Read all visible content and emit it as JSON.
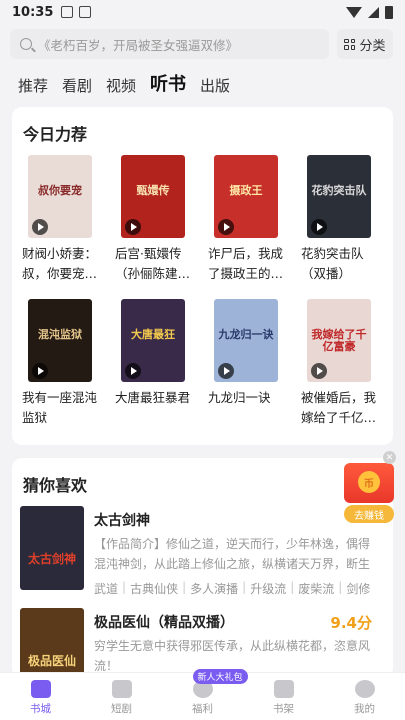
{
  "status": {
    "time": "10:35"
  },
  "search": {
    "placeholder": "《老朽百岁，开局被圣女强逼双修》",
    "category_label": "分类"
  },
  "tabs": [
    "推荐",
    "看剧",
    "视频",
    "听书",
    "出版"
  ],
  "active_tab": "听书",
  "recommend": {
    "title": "今日力荐",
    "books": [
      {
        "title": "财阀小娇妻：叔，你要宠…",
        "cover_text": "叔你要宠",
        "cover_bg": "#e9dcd6",
        "cover_fg": "#8a2b2b"
      },
      {
        "title": "后宫·甄嬛传（孙俪陈建…",
        "cover_text": "甄嬛传",
        "cover_bg": "#b3231e",
        "cover_fg": "#f6e0b0"
      },
      {
        "title": "诈尸后，我成了摄政王的…",
        "cover_text": "摄政王",
        "cover_bg": "#c7302a",
        "cover_fg": "#ffe6a6"
      },
      {
        "title": "花豹突击队（双播）",
        "cover_text": "花豹突击队",
        "cover_bg": "#2b3038",
        "cover_fg": "#d8d8d8"
      },
      {
        "title": "我有一座混沌监狱",
        "cover_text": "混沌监狱",
        "cover_bg": "#241a14",
        "cover_fg": "#e2c48a"
      },
      {
        "title": "大唐最狂暴君",
        "cover_text": "大唐最狂",
        "cover_bg": "#3a2a4a",
        "cover_fg": "#f2c94c"
      },
      {
        "title": "九龙归一诀",
        "cover_text": "九龙归一诀",
        "cover_bg": "#9db4d8",
        "cover_fg": "#2a3a6a"
      },
      {
        "title": "被催婚后，我嫁给了千亿…",
        "cover_text": "我嫁给了千亿富豪",
        "cover_bg": "#e8d7d2",
        "cover_fg": "#c0282a"
      }
    ]
  },
  "guess": {
    "title": "猜你喜欢",
    "items": [
      {
        "name": "太古剑神",
        "desc": "【作品简介】修仙之道，逆天而行，少年林逸，偶得混沌神剑，从此踏上修仙之旅，纵横诸天万界，断生死，…",
        "tags": [
          "武道",
          "古典仙侠",
          "多人演播",
          "升级流",
          "废柴流",
          "剑修"
        ],
        "score": "",
        "cover_text": "太古剑神",
        "cover_bg": "#2a2a3a",
        "cover_fg": "#e0402a"
      },
      {
        "name": "极品医仙（精品双播）",
        "desc": "穷学生无意中获得邪医传承，从此纵横花都，恣意风流！",
        "tags": [],
        "score": "9.4分",
        "cover_text": "极品医仙",
        "cover_bg": "#5a3a1a",
        "cover_fg": "#f6d27a"
      }
    ]
  },
  "float_ad": {
    "coin_text": "币",
    "label": "去赚钱"
  },
  "bottom_nav": [
    {
      "label": "书城",
      "active": true,
      "badge": ""
    },
    {
      "label": "短剧",
      "active": false,
      "badge": ""
    },
    {
      "label": "福利",
      "active": false,
      "badge": "新人大礼包"
    },
    {
      "label": "书架",
      "active": false,
      "badge": ""
    },
    {
      "label": "我的",
      "active": false,
      "badge": ""
    }
  ]
}
